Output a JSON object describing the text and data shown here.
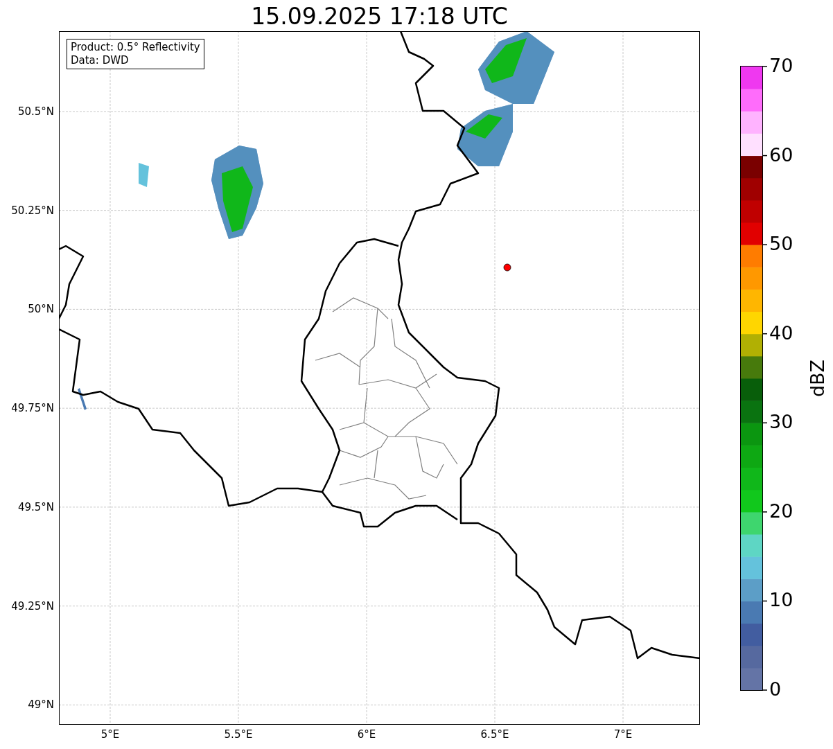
{
  "title": "15.09.2025 17:18 UTC",
  "info_box": [
    "Product: 0.5° Reflectivity",
    "Data: DWD"
  ],
  "lat_ticks": [
    "50.5°N",
    "50.25°N",
    "50°N",
    "49.75°N",
    "49.5°N",
    "49.25°N",
    "49°N"
  ],
  "lon_ticks": [
    "5°E",
    "5.5°E",
    "6°E",
    "6.5°E",
    "7°E"
  ],
  "colorbar": {
    "label": "dBZ",
    "ticks": [
      "70",
      "60",
      "50",
      "40",
      "30",
      "20",
      "10",
      "0"
    ]
  }
}
